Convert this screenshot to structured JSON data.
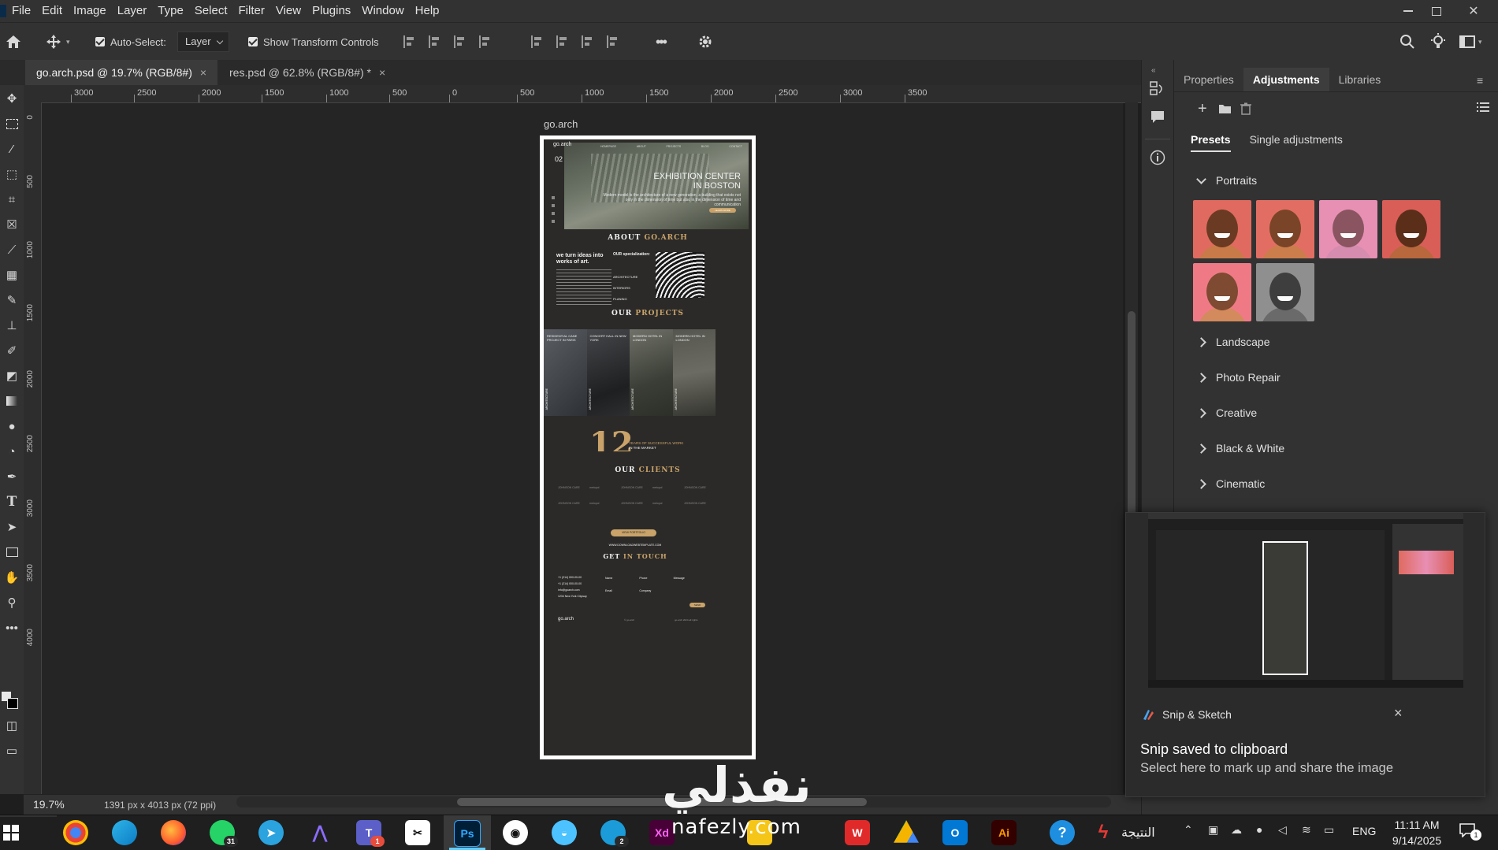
{
  "menubar": {
    "items": [
      "File",
      "Edit",
      "Image",
      "Layer",
      "Type",
      "Select",
      "Filter",
      "View",
      "Plugins",
      "Window",
      "Help"
    ]
  },
  "options": {
    "auto_select_label": "Auto-Select:",
    "layer_dropdown": "Layer",
    "transform_label": "Show Transform Controls",
    "more": "•••"
  },
  "tabs": [
    {
      "label": "go.arch.psd @ 19.7% (RGB/8#)",
      "close": "×"
    },
    {
      "label": "res.psd @ 62.8% (RGB/8#) *",
      "close": "×"
    }
  ],
  "ruler_h": [
    "3000",
    "2500",
    "2000",
    "1500",
    "1000",
    "500",
    "0",
    "500",
    "1000",
    "1500",
    "2000",
    "2500",
    "3000",
    "3500"
  ],
  "ruler_v": [
    "0",
    "5 0 0",
    "1 0 0 0",
    "1 5 0 0",
    "2 0 0 0",
    "2 5 0 0",
    "3 0 0 0",
    "3 5 0 0",
    "4 0 0 0"
  ],
  "artboard": {
    "name": "go.arch",
    "site": {
      "logo": "go.arch",
      "nav": [
        "HOMEPAGE",
        "ABOUT",
        "PROJECTS",
        "BLOG",
        "CONTACT"
      ],
      "slide": "02",
      "hero_title_1": "EXHIBITION CENTER",
      "hero_title_2": "IN BOSTON",
      "hero_text": "Modern model is the architecture of a new generation, a building that exists not only in the dimension of time but also in the dimension of time and communication",
      "hero_btn": "LEARN MORE",
      "about_a": "ABOUT",
      "about_b": "GO.ARCH",
      "about_lead": "we turn ideas into works of art.",
      "spec_title": "OUR specialization:",
      "spec_items": [
        "ARCHITECTURE",
        "INTERIORS",
        "PLANING"
      ],
      "projects_a": "OUR",
      "projects_b": "PROJECTS",
      "projects": [
        {
          "title": "RESIDENTIAL CANE PROJECT IN PARIS",
          "tag": "ARCHITECTURE"
        },
        {
          "title": "CONCERT HALL IN NEW YORK",
          "tag": "ARCHITECTURE"
        },
        {
          "title": "MODERN HOTEL IN LONDON",
          "tag": "ARCHITECTURE"
        },
        {
          "title": "MODERN HOTEL IN LONDON",
          "tag": "ARCHITECTURE"
        }
      ],
      "years_num": "12",
      "years_text_1": "YEARS OF SUCCESSFUL WORK",
      "years_text_2": "IN THE MARKET",
      "clients_a": "OUR",
      "clients_b": "CLIENTS",
      "client_names": [
        "JOHNSON CARE",
        "metopol",
        "JOHNSON CARE",
        "metopol",
        "JOHNSON CARE",
        "JOHNSON CARE",
        "metopol",
        "JOHNSON CARE",
        "metopol",
        "JOHNSON CARE"
      ],
      "portfolio_btn": "VIEW PORTFOLIO",
      "site_url": "WWW.DOWNLOADWEBTEMPLATE.COM",
      "contact_a": "GET",
      "contact_b": "IN TOUCH",
      "phone_1": "+1 (214) 000-00-00",
      "phone_2": "+1 (214) 000-00-00",
      "email": "info@goarch.com",
      "address": "1234 New York Cityway",
      "form_fields": [
        "Name",
        "Phone",
        "Message",
        "Email",
        "Company"
      ],
      "send_btn": "SEND",
      "footer_logo": "go.arch",
      "footer_mid": "© go.arch",
      "footer_right": "go.arch 2024 all rights"
    }
  },
  "status": {
    "zoom": "19.7%",
    "doc_info": "1391 px x 4013 px (72 ppi)"
  },
  "panel": {
    "tabs": [
      "Properties",
      "Adjustments",
      "Libraries"
    ],
    "active_tab": "Adjustments",
    "subtabs": [
      "Presets",
      "Single adjustments"
    ],
    "open_category": "Portraits",
    "categories": [
      "Landscape",
      "Photo Repair",
      "Creative",
      "Black & White",
      "Cinematic"
    ]
  },
  "snip": {
    "app": "Snip & Sketch",
    "title": "Snip saved to clipboard",
    "body": "Select here to mark up and share the image",
    "close": "×"
  },
  "taskbar": {
    "whatsapp_badge": "31",
    "teams_badge": "1",
    "edge_badge": "2",
    "arabic_label": "النتيجة",
    "lang": "ENG",
    "time": "11:11 AM",
    "date": "9/14/2025",
    "notif": "1",
    "ps_label": "Ps",
    "xd_label": "Xd",
    "ai_label": "Ai"
  },
  "watermark": {
    "arabic": "نفذلي",
    "latin": "nafezly.com"
  },
  "colors": {
    "accent_gold": "#c9a36a",
    "ps_blue": "#31a8ff",
    "panel_bg": "#323232",
    "canvas_bg": "#252525"
  }
}
